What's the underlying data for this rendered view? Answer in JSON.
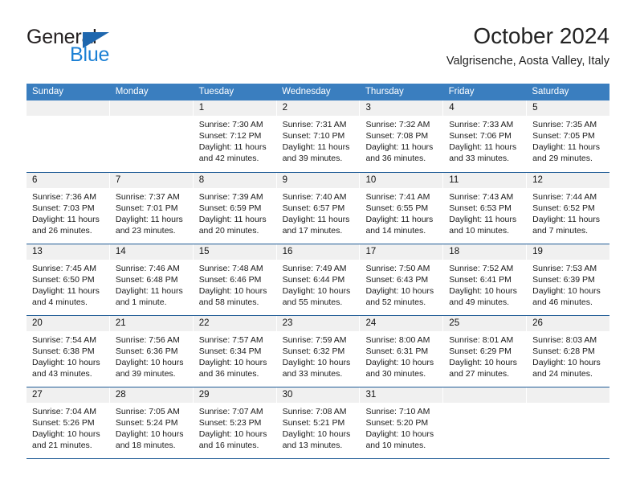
{
  "brand": {
    "name_top": "General",
    "name_bottom": "Blue",
    "triangle_color": "#1f67ae",
    "top_color": "#231f20",
    "bottom_color": "#1a7fd4"
  },
  "header": {
    "title": "October 2024",
    "subtitle": "Valgrisenche, Aosta Valley, Italy"
  },
  "colors": {
    "header_row_bg": "#3a7ebf",
    "week_divider": "#205c96",
    "day_band_bg": "#f0f0f0",
    "cell_bg": "#ffffff",
    "text": "#1a1a1a"
  },
  "weekdays": [
    "Sunday",
    "Monday",
    "Tuesday",
    "Wednesday",
    "Thursday",
    "Friday",
    "Saturday"
  ],
  "weeks": [
    [
      {
        "day": "",
        "empty": true,
        "sunrise": "",
        "sunset": "",
        "daylight1": "",
        "daylight2": ""
      },
      {
        "day": "",
        "empty": true,
        "sunrise": "",
        "sunset": "",
        "daylight1": "",
        "daylight2": ""
      },
      {
        "day": "1",
        "sunrise": "Sunrise: 7:30 AM",
        "sunset": "Sunset: 7:12 PM",
        "daylight1": "Daylight: 11 hours",
        "daylight2": "and 42 minutes."
      },
      {
        "day": "2",
        "sunrise": "Sunrise: 7:31 AM",
        "sunset": "Sunset: 7:10 PM",
        "daylight1": "Daylight: 11 hours",
        "daylight2": "and 39 minutes."
      },
      {
        "day": "3",
        "sunrise": "Sunrise: 7:32 AM",
        "sunset": "Sunset: 7:08 PM",
        "daylight1": "Daylight: 11 hours",
        "daylight2": "and 36 minutes."
      },
      {
        "day": "4",
        "sunrise": "Sunrise: 7:33 AM",
        "sunset": "Sunset: 7:06 PM",
        "daylight1": "Daylight: 11 hours",
        "daylight2": "and 33 minutes."
      },
      {
        "day": "5",
        "sunrise": "Sunrise: 7:35 AM",
        "sunset": "Sunset: 7:05 PM",
        "daylight1": "Daylight: 11 hours",
        "daylight2": "and 29 minutes."
      }
    ],
    [
      {
        "day": "6",
        "sunrise": "Sunrise: 7:36 AM",
        "sunset": "Sunset: 7:03 PM",
        "daylight1": "Daylight: 11 hours",
        "daylight2": "and 26 minutes."
      },
      {
        "day": "7",
        "sunrise": "Sunrise: 7:37 AM",
        "sunset": "Sunset: 7:01 PM",
        "daylight1": "Daylight: 11 hours",
        "daylight2": "and 23 minutes."
      },
      {
        "day": "8",
        "sunrise": "Sunrise: 7:39 AM",
        "sunset": "Sunset: 6:59 PM",
        "daylight1": "Daylight: 11 hours",
        "daylight2": "and 20 minutes."
      },
      {
        "day": "9",
        "sunrise": "Sunrise: 7:40 AM",
        "sunset": "Sunset: 6:57 PM",
        "daylight1": "Daylight: 11 hours",
        "daylight2": "and 17 minutes."
      },
      {
        "day": "10",
        "sunrise": "Sunrise: 7:41 AM",
        "sunset": "Sunset: 6:55 PM",
        "daylight1": "Daylight: 11 hours",
        "daylight2": "and 14 minutes."
      },
      {
        "day": "11",
        "sunrise": "Sunrise: 7:43 AM",
        "sunset": "Sunset: 6:53 PM",
        "daylight1": "Daylight: 11 hours",
        "daylight2": "and 10 minutes."
      },
      {
        "day": "12",
        "sunrise": "Sunrise: 7:44 AM",
        "sunset": "Sunset: 6:52 PM",
        "daylight1": "Daylight: 11 hours",
        "daylight2": "and 7 minutes."
      }
    ],
    [
      {
        "day": "13",
        "sunrise": "Sunrise: 7:45 AM",
        "sunset": "Sunset: 6:50 PM",
        "daylight1": "Daylight: 11 hours",
        "daylight2": "and 4 minutes."
      },
      {
        "day": "14",
        "sunrise": "Sunrise: 7:46 AM",
        "sunset": "Sunset: 6:48 PM",
        "daylight1": "Daylight: 11 hours",
        "daylight2": "and 1 minute."
      },
      {
        "day": "15",
        "sunrise": "Sunrise: 7:48 AM",
        "sunset": "Sunset: 6:46 PM",
        "daylight1": "Daylight: 10 hours",
        "daylight2": "and 58 minutes."
      },
      {
        "day": "16",
        "sunrise": "Sunrise: 7:49 AM",
        "sunset": "Sunset: 6:44 PM",
        "daylight1": "Daylight: 10 hours",
        "daylight2": "and 55 minutes."
      },
      {
        "day": "17",
        "sunrise": "Sunrise: 7:50 AM",
        "sunset": "Sunset: 6:43 PM",
        "daylight1": "Daylight: 10 hours",
        "daylight2": "and 52 minutes."
      },
      {
        "day": "18",
        "sunrise": "Sunrise: 7:52 AM",
        "sunset": "Sunset: 6:41 PM",
        "daylight1": "Daylight: 10 hours",
        "daylight2": "and 49 minutes."
      },
      {
        "day": "19",
        "sunrise": "Sunrise: 7:53 AM",
        "sunset": "Sunset: 6:39 PM",
        "daylight1": "Daylight: 10 hours",
        "daylight2": "and 46 minutes."
      }
    ],
    [
      {
        "day": "20",
        "sunrise": "Sunrise: 7:54 AM",
        "sunset": "Sunset: 6:38 PM",
        "daylight1": "Daylight: 10 hours",
        "daylight2": "and 43 minutes."
      },
      {
        "day": "21",
        "sunrise": "Sunrise: 7:56 AM",
        "sunset": "Sunset: 6:36 PM",
        "daylight1": "Daylight: 10 hours",
        "daylight2": "and 39 minutes."
      },
      {
        "day": "22",
        "sunrise": "Sunrise: 7:57 AM",
        "sunset": "Sunset: 6:34 PM",
        "daylight1": "Daylight: 10 hours",
        "daylight2": "and 36 minutes."
      },
      {
        "day": "23",
        "sunrise": "Sunrise: 7:59 AM",
        "sunset": "Sunset: 6:32 PM",
        "daylight1": "Daylight: 10 hours",
        "daylight2": "and 33 minutes."
      },
      {
        "day": "24",
        "sunrise": "Sunrise: 8:00 AM",
        "sunset": "Sunset: 6:31 PM",
        "daylight1": "Daylight: 10 hours",
        "daylight2": "and 30 minutes."
      },
      {
        "day": "25",
        "sunrise": "Sunrise: 8:01 AM",
        "sunset": "Sunset: 6:29 PM",
        "daylight1": "Daylight: 10 hours",
        "daylight2": "and 27 minutes."
      },
      {
        "day": "26",
        "sunrise": "Sunrise: 8:03 AM",
        "sunset": "Sunset: 6:28 PM",
        "daylight1": "Daylight: 10 hours",
        "daylight2": "and 24 minutes."
      }
    ],
    [
      {
        "day": "27",
        "sunrise": "Sunrise: 7:04 AM",
        "sunset": "Sunset: 5:26 PM",
        "daylight1": "Daylight: 10 hours",
        "daylight2": "and 21 minutes."
      },
      {
        "day": "28",
        "sunrise": "Sunrise: 7:05 AM",
        "sunset": "Sunset: 5:24 PM",
        "daylight1": "Daylight: 10 hours",
        "daylight2": "and 18 minutes."
      },
      {
        "day": "29",
        "sunrise": "Sunrise: 7:07 AM",
        "sunset": "Sunset: 5:23 PM",
        "daylight1": "Daylight: 10 hours",
        "daylight2": "and 16 minutes."
      },
      {
        "day": "30",
        "sunrise": "Sunrise: 7:08 AM",
        "sunset": "Sunset: 5:21 PM",
        "daylight1": "Daylight: 10 hours",
        "daylight2": "and 13 minutes."
      },
      {
        "day": "31",
        "sunrise": "Sunrise: 7:10 AM",
        "sunset": "Sunset: 5:20 PM",
        "daylight1": "Daylight: 10 hours",
        "daylight2": "and 10 minutes."
      },
      {
        "day": "",
        "empty": true,
        "sunrise": "",
        "sunset": "",
        "daylight1": "",
        "daylight2": ""
      },
      {
        "day": "",
        "empty": true,
        "sunrise": "",
        "sunset": "",
        "daylight1": "",
        "daylight2": ""
      }
    ]
  ]
}
